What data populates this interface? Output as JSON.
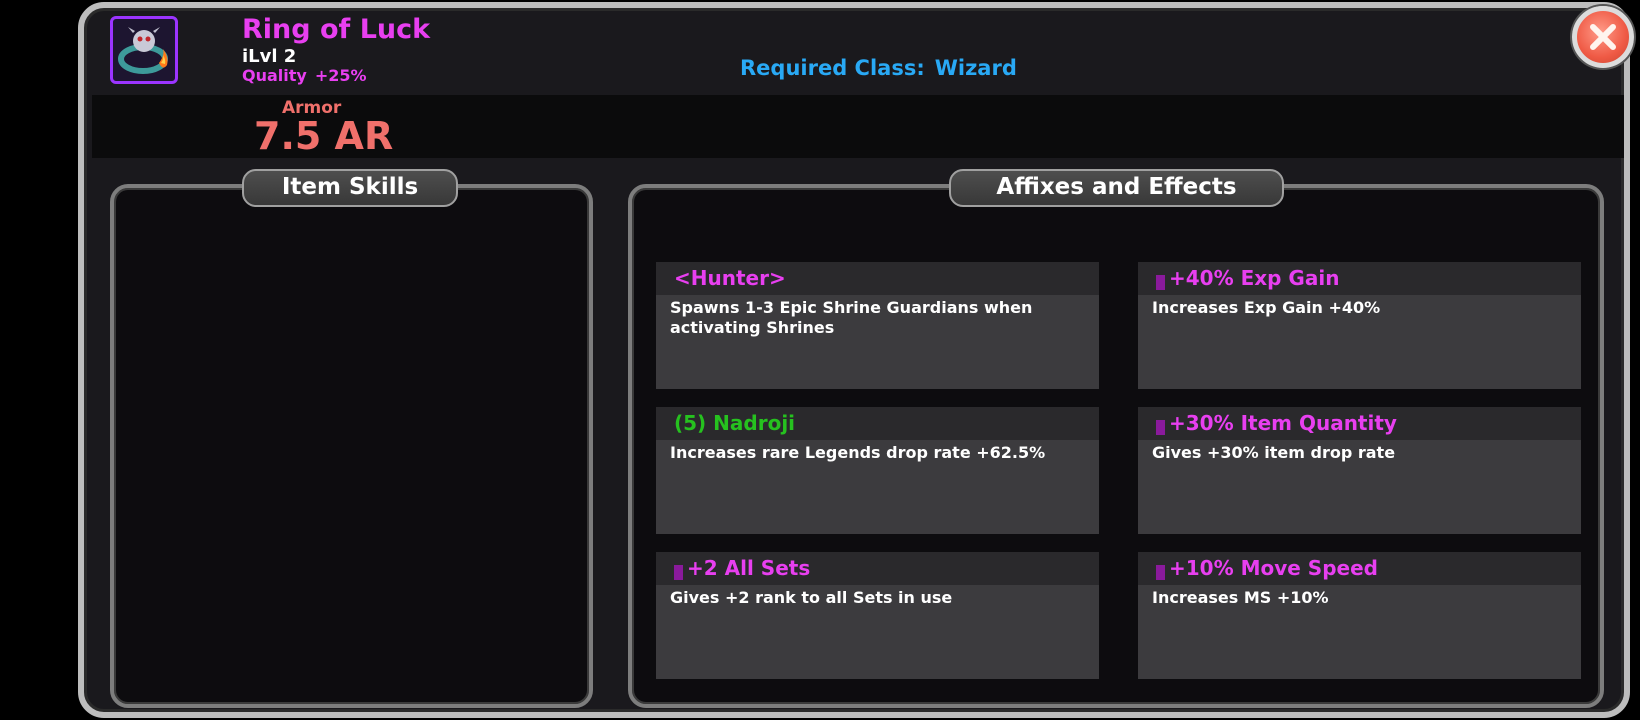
{
  "item": {
    "name": "Ring of Luck",
    "ilvl": "iLvl 2",
    "quality_label": "Quality",
    "quality_value": "+25%",
    "required_class_label": "Required Class:",
    "required_class_value": "Wizard",
    "armor_label": "Armor",
    "armor_value": "7.5 AR",
    "icon": "ring-icon"
  },
  "panels": {
    "item_skills_title": "Item Skills",
    "affixes_title": "Affixes and Effects"
  },
  "affixes": [
    {
      "title": "<Hunter>",
      "desc": "Spawns 1-3 Epic Shrine Guardians when activating Shrines",
      "color": "#e83ff0",
      "gem": false
    },
    {
      "title": "+40% Exp Gain",
      "desc": "Increases Exp Gain +40%",
      "color": "#e83ff0",
      "gem": true
    },
    {
      "title": "(5) Nadroji",
      "desc": "Increases rare Legends drop rate +62.5%",
      "color": "#26c11f",
      "gem": false
    },
    {
      "title": "+30% Item Quantity",
      "desc": "Gives +30% item drop rate",
      "color": "#e83ff0",
      "gem": true
    },
    {
      "title": "+2 All Sets",
      "desc": "Gives +2 rank to all Sets in use",
      "color": "#e83ff0",
      "gem": true
    },
    {
      "title": "+10% Move Speed",
      "desc": "Increases MS +10%",
      "color": "#e83ff0",
      "gem": true
    }
  ],
  "colors": {
    "legendary": "#e83ff0",
    "set": "#26c11f",
    "class_req": "#29a9f5",
    "armor": "#f0706b"
  },
  "close_icon": "close-icon"
}
